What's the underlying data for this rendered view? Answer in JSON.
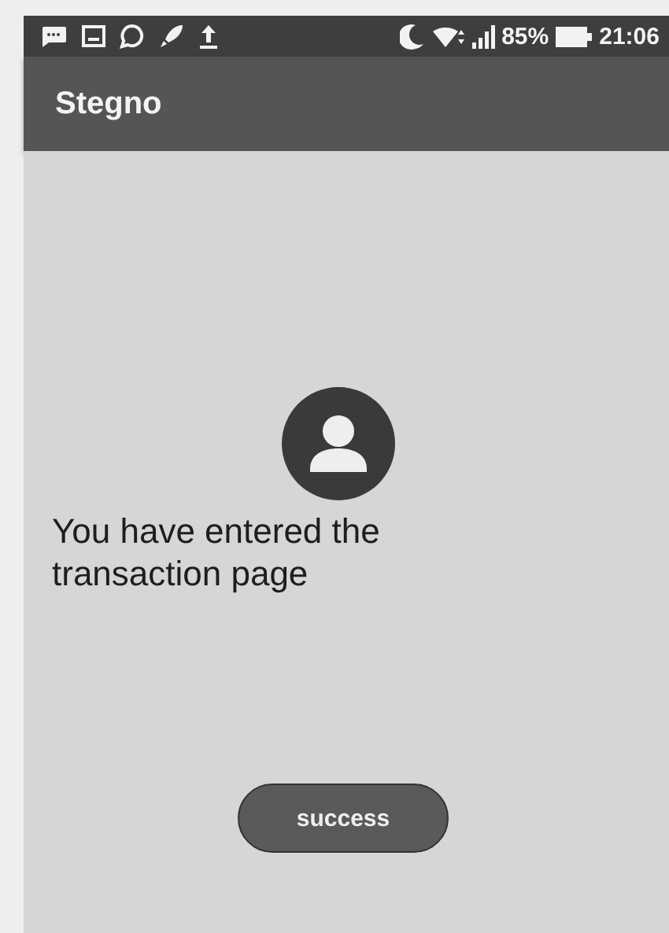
{
  "status_bar": {
    "battery": "85%",
    "time": "21:06"
  },
  "app_bar": {
    "title": "Stegno"
  },
  "content": {
    "message": "You have entered the transaction page",
    "button": "success"
  }
}
